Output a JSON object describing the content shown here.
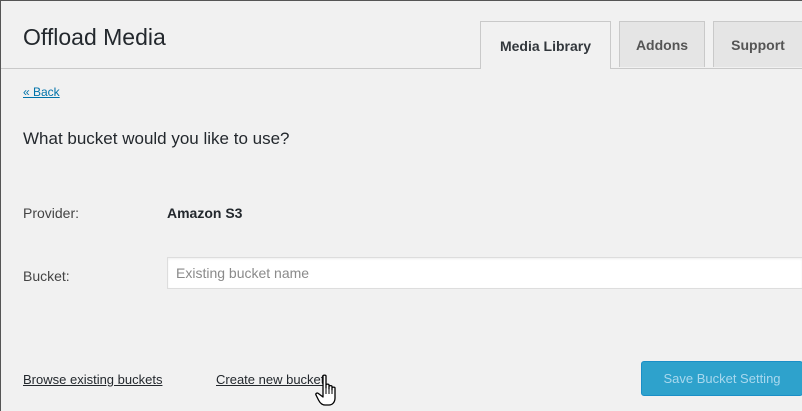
{
  "header": {
    "title": "Offload Media",
    "tabs": [
      {
        "label": "Media Library",
        "active": true
      },
      {
        "label": "Addons",
        "active": false
      },
      {
        "label": "Support",
        "active": false
      }
    ]
  },
  "nav": {
    "back_label": "« Back"
  },
  "main": {
    "question": "What bucket would you like to use?",
    "provider": {
      "label": "Provider:",
      "value": "Amazon S3"
    },
    "bucket": {
      "label": "Bucket:",
      "value": "",
      "placeholder": "Existing bucket name"
    }
  },
  "footer": {
    "browse_label": "Browse existing buckets",
    "create_label": "Create new bucket",
    "save_label": "Save Bucket Setting"
  },
  "colors": {
    "link": "#0073aa",
    "primary_button": "#2ea2cc",
    "background": "#f1f1f1"
  },
  "icons": {
    "cursor": "hand-pointer-icon"
  }
}
